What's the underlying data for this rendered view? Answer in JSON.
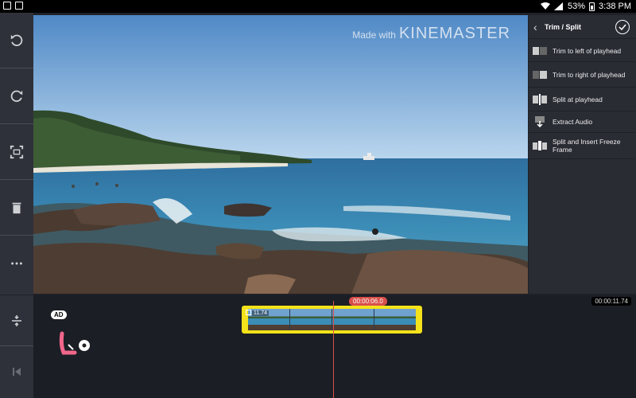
{
  "status_bar": {
    "battery": "53%",
    "time": "3:38 PM"
  },
  "watermark": {
    "prefix": "Made with",
    "brand": "KINEMASTER"
  },
  "left_toolbar": {
    "undo_icon": "undo-icon",
    "redo_icon": "redo-icon",
    "fullscreen_icon": "fullscreen-icon",
    "delete_icon": "trash-icon",
    "more_icon": "more-icon"
  },
  "trim_panel": {
    "title": "Trim / Split",
    "items": [
      {
        "label": "Trim to left of playhead",
        "icon": "trim-left-icon"
      },
      {
        "label": "Trim to right of playhead",
        "icon": "trim-right-icon"
      },
      {
        "label": "Split at playhead",
        "icon": "split-icon"
      },
      {
        "label": "Extract Audio",
        "icon": "extract-audio-icon"
      },
      {
        "label": "Split and Insert Freeze Frame",
        "icon": "freeze-frame-icon"
      }
    ]
  },
  "timeline": {
    "current_time": "00:00:06.0",
    "total_time": "00:00:11.74",
    "clip_duration": "11.74"
  },
  "ad": {
    "badge": "AD"
  },
  "colors": {
    "accent_red": "#d8504a",
    "clip_yellow": "#f4e21a",
    "panel_bg": "#2a2c34"
  }
}
